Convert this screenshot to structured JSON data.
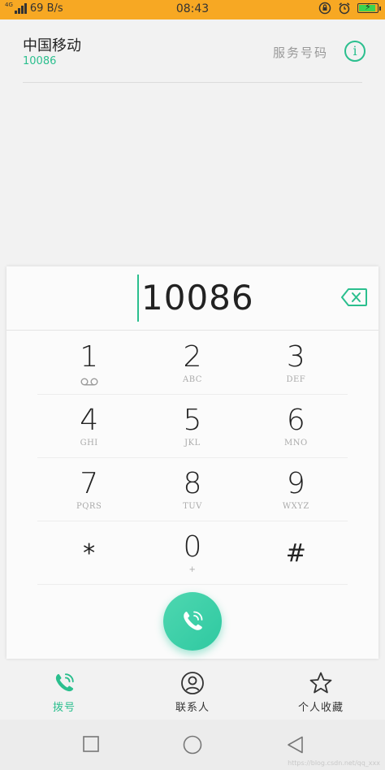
{
  "status_bar": {
    "network": "4G",
    "speed": "69 B/s",
    "time": "08:43",
    "battery_level": 0.9,
    "battery_charging": true
  },
  "header": {
    "carrier": "中国移动",
    "carrier_number": "10086",
    "service_label": "服务号码",
    "info_icon": "info-icon"
  },
  "dialer": {
    "number": "10086",
    "backspace_icon": "backspace-icon",
    "keys": [
      {
        "digit": "1",
        "letters": "",
        "icon": "voicemail-icon"
      },
      {
        "digit": "2",
        "letters": "ABC"
      },
      {
        "digit": "3",
        "letters": "DEF"
      },
      {
        "digit": "4",
        "letters": "GHI"
      },
      {
        "digit": "5",
        "letters": "JKL"
      },
      {
        "digit": "6",
        "letters": "MNO"
      },
      {
        "digit": "7",
        "letters": "PQRS"
      },
      {
        "digit": "8",
        "letters": "TUV"
      },
      {
        "digit": "9",
        "letters": "WXYZ"
      },
      {
        "digit": "*",
        "letters": ""
      },
      {
        "digit": "0",
        "letters": "+"
      },
      {
        "digit": "#",
        "letters": ""
      }
    ],
    "call_icon": "phone-icon"
  },
  "tabs": [
    {
      "label": "拨号",
      "icon": "phone-icon",
      "active": true
    },
    {
      "label": "联系人",
      "icon": "person-icon",
      "active": false
    },
    {
      "label": "个人收藏",
      "icon": "star-icon",
      "active": false
    }
  ],
  "nav": {
    "recent_icon": "square-icon",
    "home_icon": "circle-icon",
    "back_icon": "triangle-back-icon"
  },
  "watermark": "https://blog.csdn.net/qq_xxx",
  "colors": {
    "status_bar": "#f7a823",
    "accent": "#2bbf8e"
  }
}
